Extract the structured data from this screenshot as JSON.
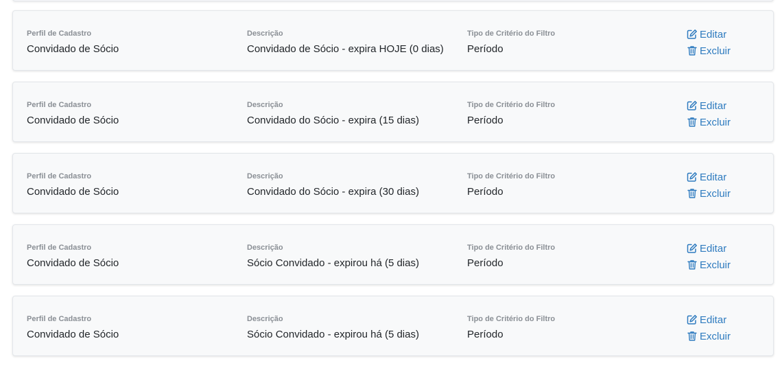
{
  "columns": {
    "profile_label": "Perfil de Cadastro",
    "description_label": "Descrição",
    "filter_type_label": "Tipo de Critério do Filtro"
  },
  "actions": {
    "edit_label": "Editar",
    "delete_label": "Excluir",
    "edit_icon": "edit-icon",
    "delete_icon": "trash-icon"
  },
  "colors": {
    "accent": "#2e7bbf",
    "card_background": "#f8f9fa",
    "label": "#8a8f95"
  },
  "rows": [
    {
      "profile": "Convidado de Sócio",
      "description": "Convidado de Sócio - expira HOJE (0 dias)",
      "filter_type": "Período"
    },
    {
      "profile": "Convidado de Sócio",
      "description": "Convidado do Sócio - expira (15 dias)",
      "filter_type": "Período"
    },
    {
      "profile": "Convidado de Sócio",
      "description": "Convidado do Sócio - expira (30 dias)",
      "filter_type": "Período"
    },
    {
      "profile": "Convidado de Sócio",
      "description": "Sócio Convidado - expirou há (5 dias)",
      "filter_type": "Período"
    },
    {
      "profile": "Convidado de Sócio",
      "description": "Sócio Convidado - expirou há (5 dias)",
      "filter_type": "Período"
    }
  ]
}
